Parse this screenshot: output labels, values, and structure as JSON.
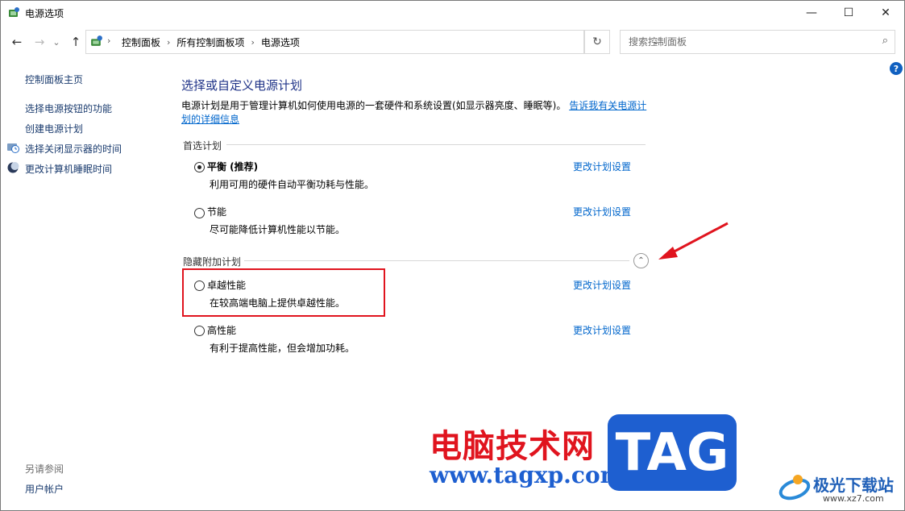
{
  "window": {
    "title": "电源选项",
    "minimize_glyph": "—",
    "maximize_glyph": "☐",
    "close_glyph": "✕"
  },
  "nav": {
    "back_glyph": "←",
    "forward_glyph": "→",
    "history_glyph": "⌄",
    "up_glyph": "↑",
    "dropdown_glyph": "⌄",
    "refresh_glyph": "↻"
  },
  "breadcrumb": {
    "items": [
      "控制面板",
      "所有控制面板项",
      "电源选项"
    ],
    "separator": "›"
  },
  "search": {
    "placeholder": "搜索控制面板",
    "icon_glyph": "⌕"
  },
  "help_glyph": "?",
  "sidebar": {
    "home": "控制面板主页",
    "links": [
      "选择电源按钮的功能",
      "创建电源计划",
      "选择关闭显示器的时间",
      "更改计算机睡眠时间"
    ],
    "see_also_label": "另请参阅",
    "see_also_links": [
      "用户帐户"
    ]
  },
  "main": {
    "title": "选择或自定义电源计划",
    "description": "电源计划是用于管理计算机如何使用电源的一套硬件和系统设置(如显示器亮度、睡眠等)。",
    "description_link": "告诉我有关电源计划的详细信息",
    "preferred_label": "首选计划",
    "hidden_label": "隐藏附加计划",
    "collapse_glyph": "⌃",
    "change_label": "更改计划设置",
    "plans": [
      {
        "name": "平衡 (推荐)",
        "desc": "利用可用的硬件自动平衡功耗与性能。",
        "selected": true
      },
      {
        "name": "节能",
        "desc": "尽可能降低计算机性能以节能。",
        "selected": false
      },
      {
        "name": "卓越性能",
        "desc": "在较高端电脑上提供卓越性能。",
        "selected": false
      },
      {
        "name": "高性能",
        "desc": "有利于提高性能，但会增加功耗。",
        "selected": false
      }
    ]
  },
  "watermark": {
    "cn": "电脑技术网",
    "url": "www.tagxp.com",
    "tag": "TAG",
    "logo_text": "极光下载站",
    "logo_url": "www.xz7.com"
  },
  "colors": {
    "accent_link": "#0066cc",
    "title_blue": "#1e3287",
    "highlight_red": "#e0141e"
  }
}
